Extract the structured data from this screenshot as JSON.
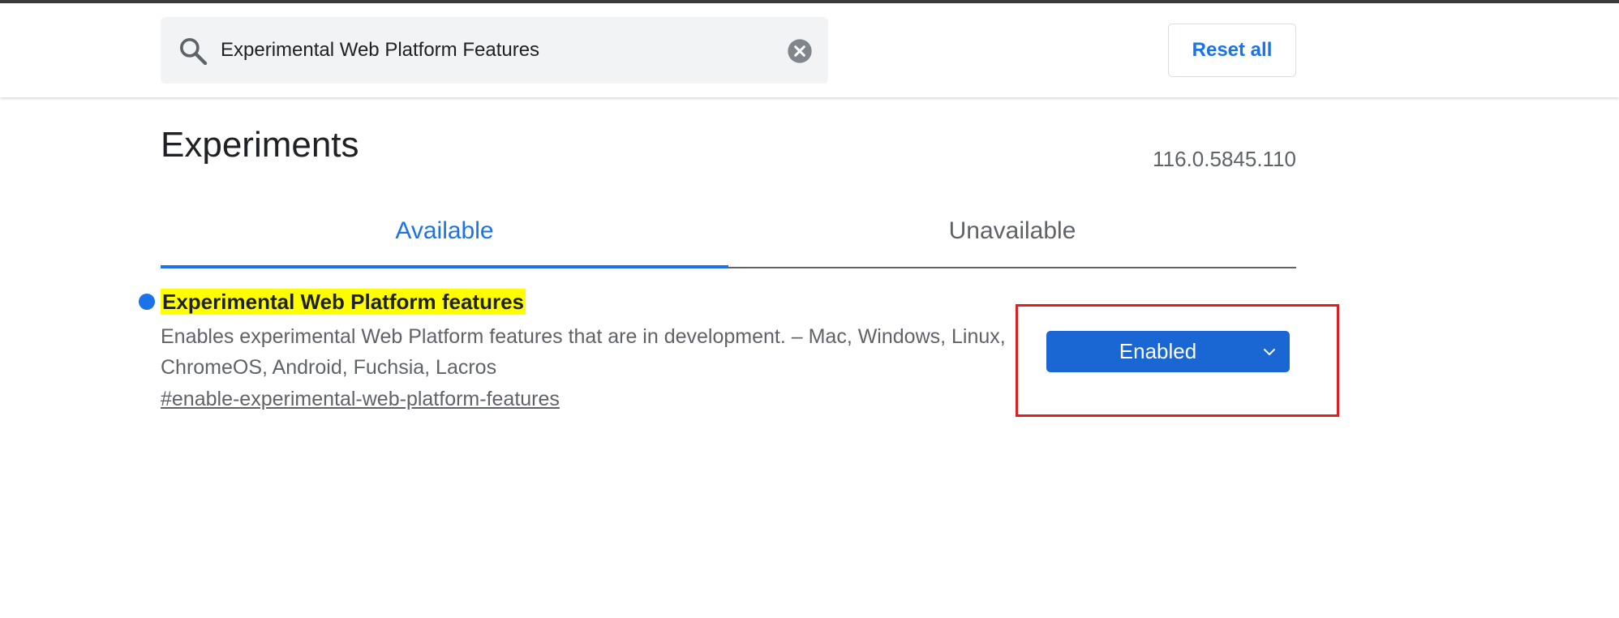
{
  "search": {
    "value": "Experimental Web Platform Features",
    "placeholder": "Search flags"
  },
  "toolbar": {
    "reset_label": "Reset all"
  },
  "page": {
    "title": "Experiments",
    "version": "116.0.5845.110"
  },
  "tabs": [
    {
      "label": "Available",
      "active": true
    },
    {
      "label": "Unavailable",
      "active": false
    }
  ],
  "experiment": {
    "title": "Experimental Web Platform features",
    "description": "Enables experimental Web Platform features that are in development. – Mac, Windows, Linux, ChromeOS, Android, Fuchsia, Lacros",
    "link": "#enable-experimental-web-platform-features",
    "selected_option": "Enabled"
  },
  "colors": {
    "accent": "#1a73e8",
    "select_bg": "#1a66d2",
    "highlight": "#ffff00",
    "annotation_border": "#e02020"
  },
  "icons": [
    "search-icon",
    "clear-icon",
    "chevron-down-icon",
    "modified-indicator-dot"
  ]
}
